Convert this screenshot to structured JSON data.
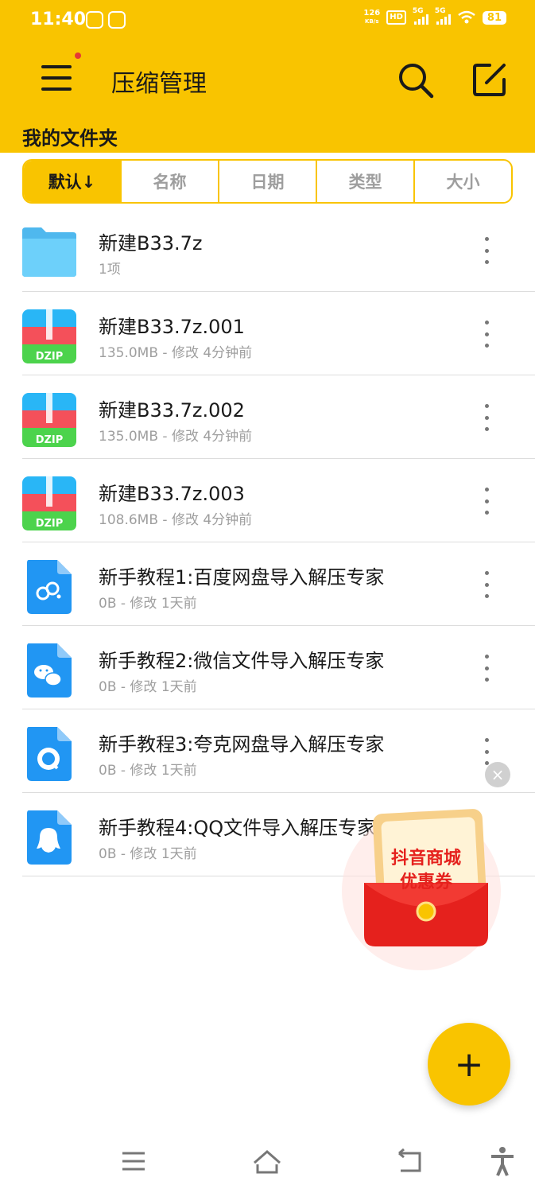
{
  "status_bar": {
    "time": "11:40",
    "net_speed_value": "126",
    "net_speed_unit": "KB/s",
    "hd_label": "HD",
    "signal1": "5G",
    "signal2": "5G",
    "battery": "81"
  },
  "app_bar": {
    "title": "压缩管理",
    "folder_title": "我的文件夹"
  },
  "sort_tabs": [
    {
      "label": "默认↓",
      "active": true
    },
    {
      "label": "名称",
      "active": false
    },
    {
      "label": "日期",
      "active": false
    },
    {
      "label": "类型",
      "active": false
    },
    {
      "label": "大小",
      "active": false
    }
  ],
  "files": [
    {
      "name": "新建B33.7z",
      "meta": "1项",
      "icon": "folder-icon"
    },
    {
      "name": "新建B33.7z.001",
      "meta": "135.0MB - 修改 4分钟前",
      "icon": "dzip-icon"
    },
    {
      "name": "新建B33.7z.002",
      "meta": "135.0MB - 修改 4分钟前",
      "icon": "dzip-icon"
    },
    {
      "name": "新建B33.7z.003",
      "meta": "108.6MB - 修改 4分钟前",
      "icon": "dzip-icon"
    },
    {
      "name": "新手教程1:百度网盘导入解压专家",
      "meta": "0B - 修改 1天前",
      "icon": "baidu-doc-icon"
    },
    {
      "name": "新手教程2:微信文件导入解压专家",
      "meta": "0B - 修改 1天前",
      "icon": "wechat-doc-icon"
    },
    {
      "name": "新手教程3:夸克网盘导入解压专家",
      "meta": "0B - 修改 1天前",
      "icon": "quark-doc-icon"
    },
    {
      "name": "新手教程4:QQ文件导入解压专家",
      "meta": "0B - 修改 1天前",
      "icon": "qq-doc-icon"
    }
  ],
  "dzip_label": "DZIP",
  "promo": {
    "line1": "抖音商城",
    "line2": "优惠券",
    "close": "×"
  },
  "fab_label": "+",
  "colors": {
    "accent": "#F9C400",
    "folder": "#5BC8F5",
    "doc_blue": "#2196F3"
  }
}
